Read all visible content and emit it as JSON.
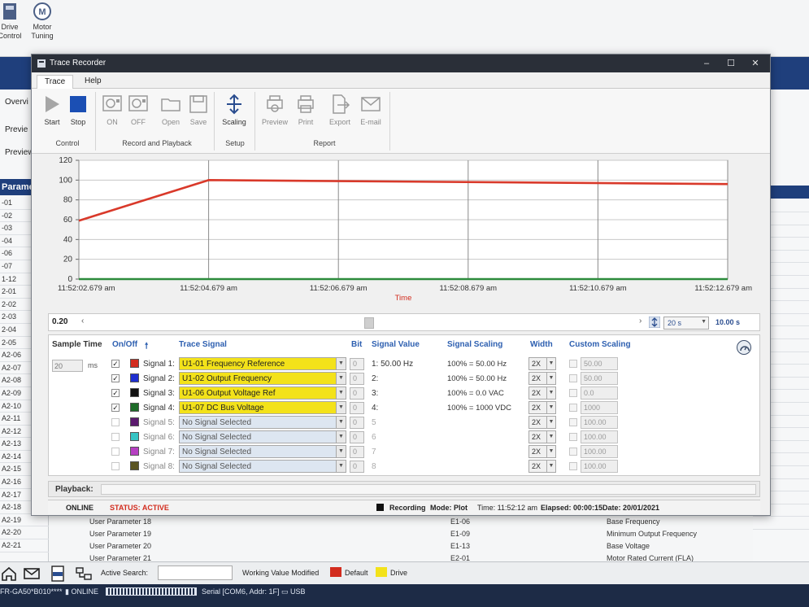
{
  "background": {
    "tools": [
      {
        "label_line1": "Drive",
        "label_line2": "Control"
      },
      {
        "label_line1": "Motor",
        "label_line2": "Tuning"
      }
    ],
    "tabs": [
      "Overvi",
      "Previe",
      "Preview t"
    ],
    "param_header": "Parameter",
    "params": [
      "-01",
      "-02",
      "-03",
      "-04",
      "-06",
      "-07",
      "1-12",
      "2-01",
      "2-02",
      "2-03",
      "2-04",
      "2-05",
      "A2-06",
      "A2-07",
      "A2-08",
      "A2-09",
      "A2-10",
      "A2-11",
      "A2-12",
      "A2-13",
      "A2-14",
      "A2-15",
      "A2-16",
      "A2-17",
      "A2-18",
      "A2-19",
      "A2-20",
      "A2-21"
    ],
    "bottom_params": [
      {
        "name": "User Parameter 18",
        "code": "E1-06",
        "desc": "Base Frequency"
      },
      {
        "name": "User Parameter 19",
        "code": "E1-09",
        "desc": "Minimum Output Frequency"
      },
      {
        "name": "User Parameter 20",
        "code": "E1-13",
        "desc": "Base Voltage"
      },
      {
        "name": "User Parameter 21",
        "code": "E2-01",
        "desc": "Motor Rated Current (FLA)"
      }
    ],
    "taskbar": {
      "active_search_label": "Active Search:",
      "working_value_label": "Working Value Modified",
      "default_label": "Default",
      "drive_label": "Drive",
      "default_color": "#d22c1e",
      "drive_color": "#f3e21a"
    },
    "statusbar": {
      "model": "FR-GA50*B010****",
      "online": "ONLINE",
      "serial": "Serial [COM6, Addr: 1F]",
      "usb": "USB"
    }
  },
  "window": {
    "title": "Trace Recorder",
    "tabs": [
      "Trace",
      "Help"
    ],
    "ribbon": {
      "buttons": [
        {
          "label": "Start",
          "icon": "play-icon"
        },
        {
          "label": "Stop",
          "icon": "stop-icon"
        },
        {
          "label": "ON",
          "icon": "record-on-icon"
        },
        {
          "label": "OFF",
          "icon": "record-off-icon"
        },
        {
          "label": "Open",
          "icon": "folder-icon"
        },
        {
          "label": "Save",
          "icon": "save-icon"
        },
        {
          "label": "Scaling",
          "icon": "scaling-icon"
        },
        {
          "label": "Preview",
          "icon": "print-preview-icon"
        },
        {
          "label": "Print",
          "icon": "printer-icon"
        },
        {
          "label": "Export",
          "icon": "export-icon"
        },
        {
          "label": "E-mail",
          "icon": "email-icon"
        }
      ],
      "groups": [
        "Control",
        "Record and Playback",
        "Setup",
        "Report"
      ]
    },
    "chart": {
      "zoom_value": "0.20",
      "range_option": "20 s",
      "range_value": "10.00 s"
    },
    "signals_panel": {
      "headers": {
        "sample_time": "Sample Time",
        "on_off": "On/Off",
        "trace_signal": "Trace Signal",
        "bit": "Bit",
        "signal_value": "Signal Value",
        "signal_scaling": "Signal Scaling",
        "width": "Width",
        "custom_scaling": "Custom Scaling"
      },
      "sample_time_value": "20",
      "sample_time_unit": "ms",
      "rows": [
        {
          "on": true,
          "name": "Signal 1:",
          "color": "#d22c1e",
          "signal": "U1-01 Frequency Reference",
          "bit": "0",
          "value": "1: 50.00 Hz",
          "scaling": "100% = 50.00 Hz",
          "width": "2X",
          "custom": "50.00"
        },
        {
          "on": true,
          "name": "Signal 2:",
          "color": "#1f2fd0",
          "signal": "U1-02 Output Frequency",
          "bit": "0",
          "value": "2:",
          "scaling": "100% = 50.00 Hz",
          "width": "2X",
          "custom": "50.00"
        },
        {
          "on": true,
          "name": "Signal 3:",
          "color": "#111111",
          "signal": "U1-06 Output Voltage Ref",
          "bit": "0",
          "value": "3:",
          "scaling": "100% = 0.0 VAC",
          "width": "2X",
          "custom": "0.0"
        },
        {
          "on": true,
          "name": "Signal 4:",
          "color": "#1d6b28",
          "signal": "U1-07 DC Bus Voltage",
          "bit": "0",
          "value": "4:",
          "scaling": "100% = 1000 VDC",
          "width": "2X",
          "custom": "1000"
        },
        {
          "on": false,
          "name": "Signal 5:",
          "color": "#5b1a6e",
          "signal": "No Signal Selected",
          "bit": "0",
          "value": "5",
          "scaling": "",
          "width": "2X",
          "custom": "100.00"
        },
        {
          "on": false,
          "name": "Signal 6:",
          "color": "#35c4c4",
          "signal": "No Signal Selected",
          "bit": "0",
          "value": "6",
          "scaling": "",
          "width": "2X",
          "custom": "100.00"
        },
        {
          "on": false,
          "name": "Signal 7:",
          "color": "#b63fc2",
          "signal": "No Signal Selected",
          "bit": "0",
          "value": "7",
          "scaling": "",
          "width": "2X",
          "custom": "100.00"
        },
        {
          "on": false,
          "name": "Signal 8:",
          "color": "#5a5422",
          "signal": "No Signal Selected",
          "bit": "0",
          "value": "8",
          "scaling": "",
          "width": "2X",
          "custom": "100.00"
        }
      ]
    },
    "playback_label": "Playback:",
    "status": {
      "online": "ONLINE",
      "status": "STATUS: ACTIVE",
      "recording": "Recording",
      "mode": "Mode: Plot",
      "time": "Time: 11:52:12 am",
      "elapsed": "Elapsed: 00:00:15",
      "date": "Date: 20/01/2021"
    }
  },
  "chart_data": {
    "type": "line",
    "xlabel": "Time",
    "ylabel": "",
    "x_ticks": [
      "11:52:02.679 am",
      "11:52:04.679 am",
      "11:52:06.679 am",
      "11:52:08.679 am",
      "11:52:10.679 am",
      "11:52:12.679 am"
    ],
    "xlim": [
      0,
      10
    ],
    "ylim": [
      0,
      120
    ],
    "y_ticks": [
      0,
      20,
      40,
      60,
      80,
      100,
      120
    ],
    "grid": true,
    "series": [
      {
        "color": "#d9392a",
        "x": [
          0,
          2,
          10
        ],
        "y": [
          59,
          100,
          96
        ]
      },
      {
        "color": "#2d8b3c",
        "x": [
          0,
          10
        ],
        "y": [
          0,
          0
        ]
      }
    ]
  }
}
